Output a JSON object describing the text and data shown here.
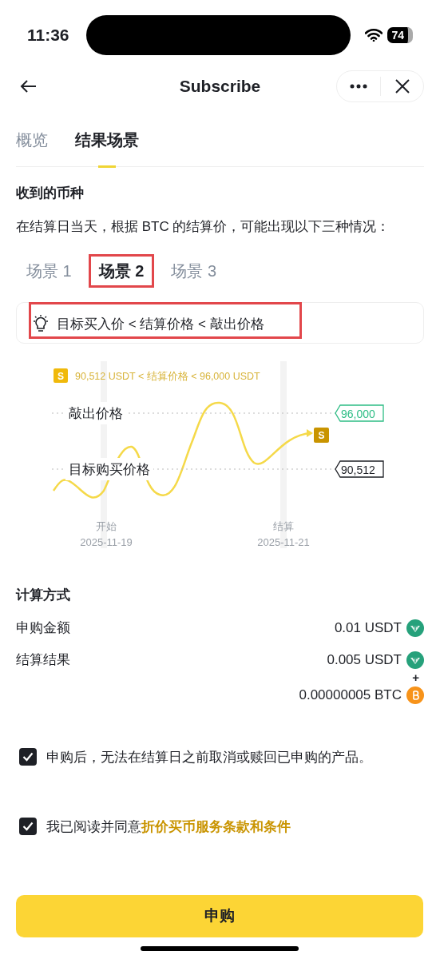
{
  "status_bar": {
    "time": "11:36",
    "battery": "74"
  },
  "nav": {
    "title": "Subscribe"
  },
  "tabs": [
    {
      "label": "概览",
      "selected": false
    },
    {
      "label": "结果场景",
      "selected": true
    }
  ],
  "section_title": "收到的币种",
  "description": "在结算日当天，根据 BTC 的结算价，可能出现以下三种情况：",
  "scenarios": [
    {
      "label": "场景 1",
      "selected": false,
      "highlighted": false
    },
    {
      "label": "场景 2",
      "selected": true,
      "highlighted": true
    },
    {
      "label": "场景 3",
      "selected": false,
      "highlighted": false
    }
  ],
  "tip": {
    "text": "目标买入价 < 结算价格 < 敲出价格",
    "highlighted": true
  },
  "chart": {
    "legend_badge": "S",
    "legend": "90,512 USDT < 结算价格 < 96,000 USDT",
    "marker": "S",
    "lines": [
      {
        "kind": "knockout",
        "label": "敲出价格",
        "value": "96,000"
      },
      {
        "kind": "target",
        "label": "目标购买价格",
        "value": "90,512"
      }
    ],
    "axis": [
      {
        "label": "开始",
        "date": "2025-11-19"
      },
      {
        "label": "结算",
        "date": "2025-11-21"
      }
    ]
  },
  "calc_title": "计算方式",
  "calc_rows": [
    {
      "label": "申购金额",
      "values": [
        {
          "amount": "0.01 USDT",
          "kind": "usdt"
        }
      ]
    },
    {
      "label": "结算结果",
      "joiner": "+",
      "values": [
        {
          "amount": "0.005 USDT",
          "kind": "usdt"
        },
        {
          "amount": "0.00000005 BTC",
          "kind": "btc"
        }
      ]
    }
  ],
  "agreements": [
    {
      "text": "申购后，无法在结算日之前取消或赎回已申购的产品。",
      "checked": true
    },
    {
      "text": "我已阅读并同意",
      "link": "折价买币服务条款和条件",
      "checked": true
    }
  ],
  "submit": "申购"
}
